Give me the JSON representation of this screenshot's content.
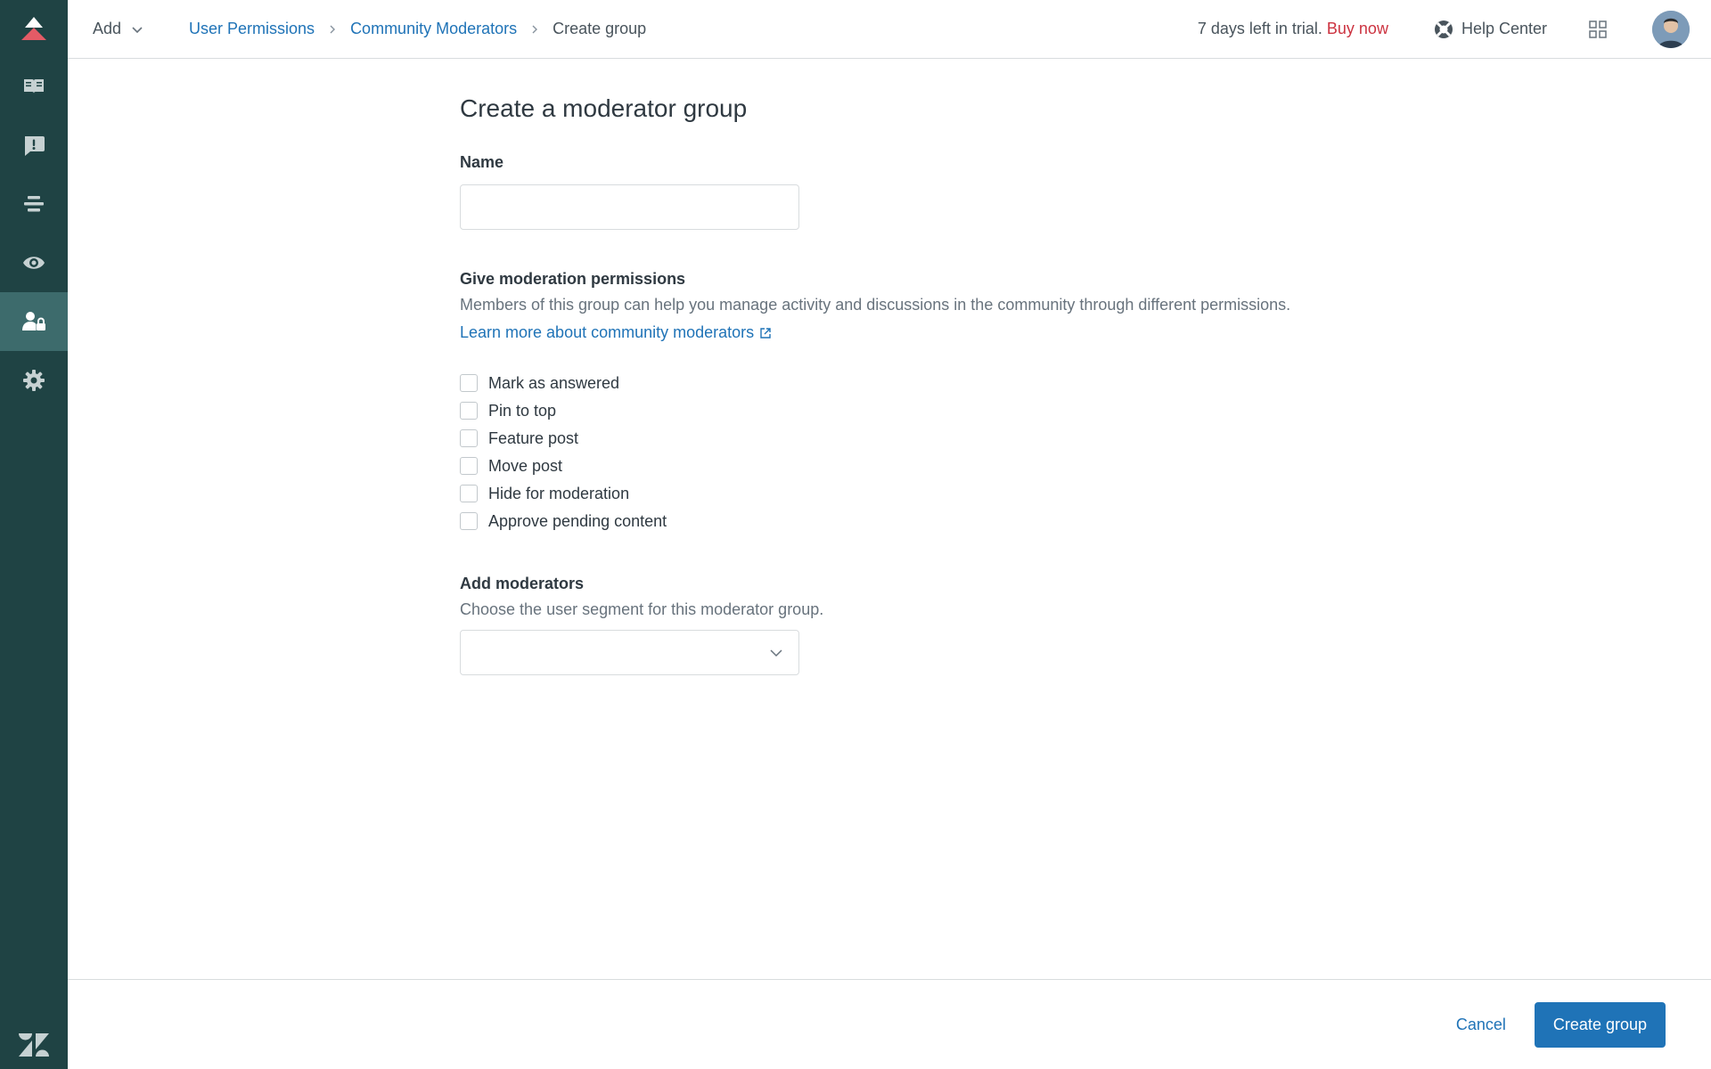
{
  "sidebar": {
    "items": [
      {
        "icon": "book-icon",
        "active": false
      },
      {
        "icon": "alert-message-icon",
        "active": false
      },
      {
        "icon": "align-icon",
        "active": false
      },
      {
        "icon": "eye-icon",
        "active": false
      },
      {
        "icon": "user-lock-icon",
        "active": true
      },
      {
        "icon": "gear-icon",
        "active": false
      }
    ]
  },
  "topbar": {
    "add_label": "Add",
    "breadcrumb": [
      "User Permissions",
      "Community Moderators",
      "Create group"
    ],
    "trial_text": "7 days left in trial.",
    "buy_now": "Buy now",
    "help_center": "Help Center"
  },
  "form": {
    "title": "Create a moderator group",
    "name_label": "Name",
    "name_value": "",
    "permissions_label": "Give moderation permissions",
    "permissions_hint": "Members of this group can help you manage activity and discussions in the community through different permissions.",
    "learn_more": "Learn more about community moderators",
    "permissions": [
      "Mark as answered",
      "Pin to top",
      "Feature post",
      "Move post",
      "Hide for moderation",
      "Approve pending content"
    ],
    "moderators_label": "Add moderators",
    "moderators_hint": "Choose the user segment for this moderator group.",
    "segment_value": ""
  },
  "footer": {
    "cancel": "Cancel",
    "submit": "Create group"
  },
  "colors": {
    "sidebar_bg": "#1f4344",
    "sidebar_active": "#3d6b6c",
    "link": "#1f73b7",
    "buy_now": "#cc3340",
    "logo_accent": "#e35b66"
  }
}
